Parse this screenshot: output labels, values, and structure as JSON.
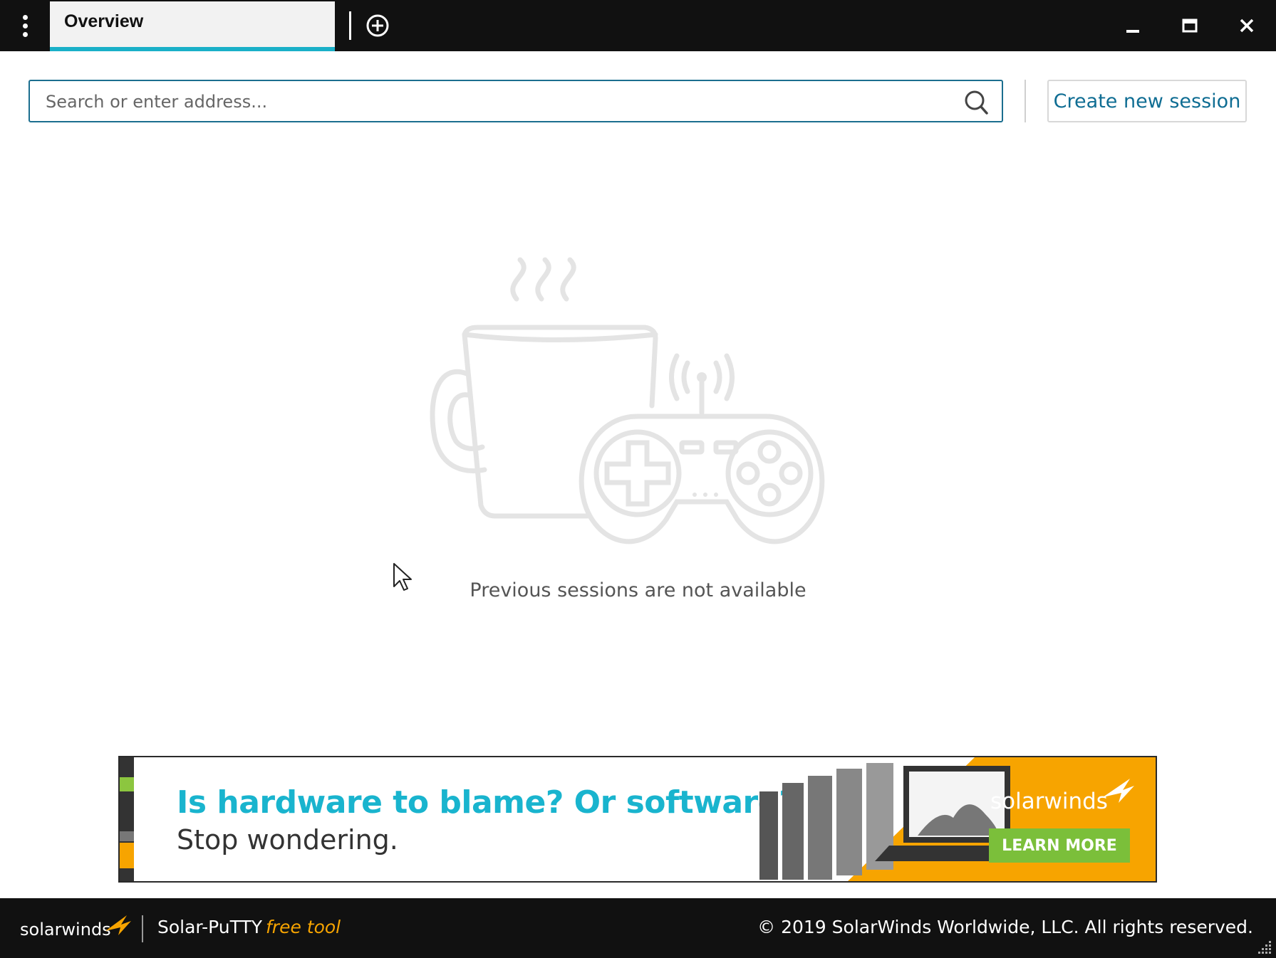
{
  "titlebar": {
    "tab_label": "Overview",
    "icons": [
      "kebab-menu-icon",
      "plus-circle-icon",
      "minimize-icon",
      "maximize-icon",
      "close-icon"
    ]
  },
  "search": {
    "placeholder": "Search or enter address...",
    "value": ""
  },
  "create_button_label": "Create new session",
  "empty_state": {
    "message": "Previous sessions are not available",
    "illustration_icons": [
      "coffee-cup-icon",
      "gamepad-icon"
    ]
  },
  "ad": {
    "headline": "Is hardware to blame? Or software?",
    "subline": "Stop wondering.",
    "brand": "solarwinds",
    "cta": "LEARN MORE"
  },
  "footer": {
    "brand": "solarwinds",
    "product": "Solar-PuTTY",
    "tag": "free tool",
    "copyright": "© 2019 SolarWinds Worldwide, LLC. All rights reserved."
  },
  "colors": {
    "titlebar_bg": "#111111",
    "tab_underline": "#1ab0c8",
    "primary_blue": "#0f6d93",
    "ad_headline": "#19b4ce",
    "ad_orange": "#f7a400",
    "ad_green": "#7bbf3a"
  }
}
